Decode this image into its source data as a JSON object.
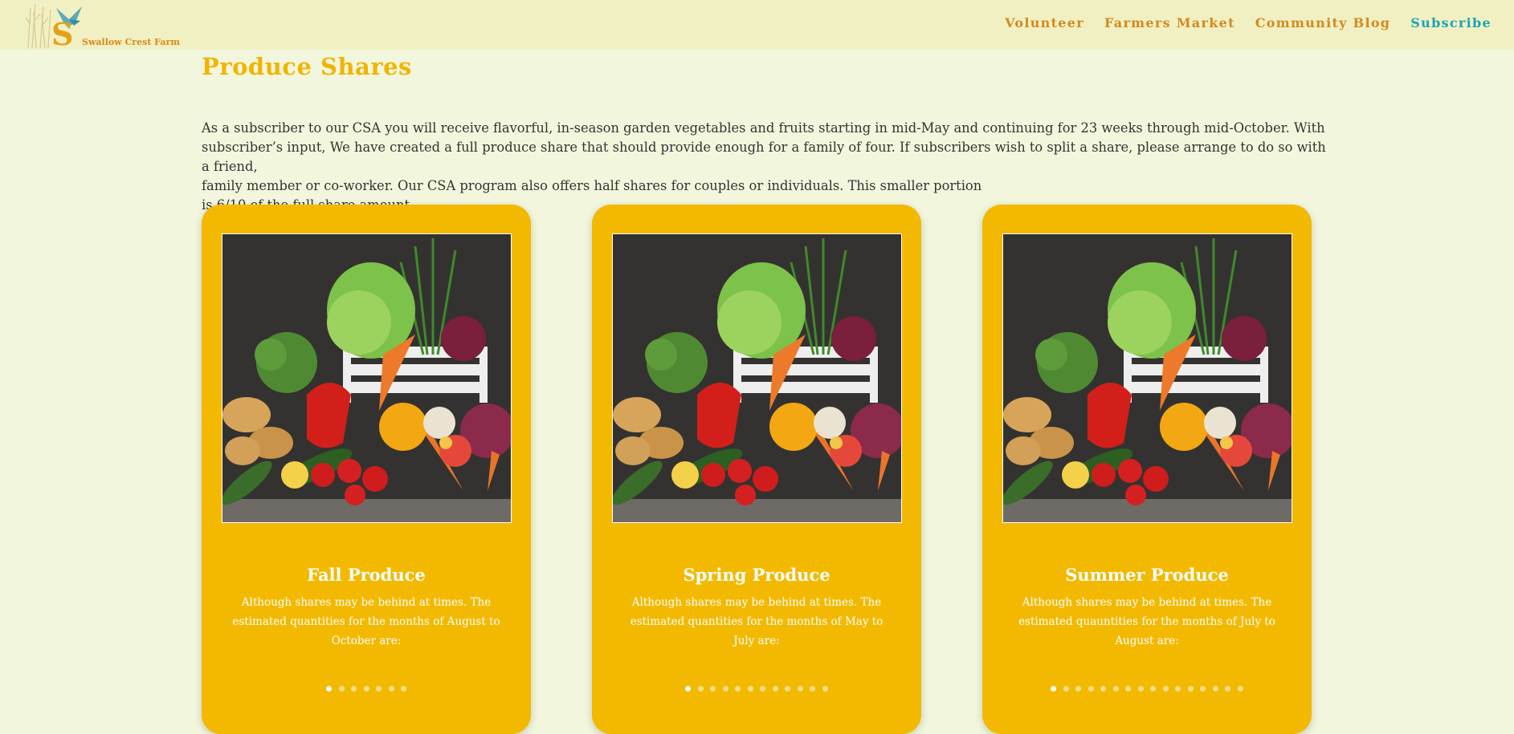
{
  "brand": {
    "name": "Swallow Crest Farm",
    "accent": "#f1b400",
    "nav_color": "#d28a1e",
    "active_color": "#1aa3b8"
  },
  "nav": [
    {
      "label": "Volunteer",
      "active": false
    },
    {
      "label": "Farmers Market",
      "active": false
    },
    {
      "label": "Community Blog",
      "active": false
    },
    {
      "label": "Subscribe",
      "active": true
    }
  ],
  "page": {
    "title": "Produce Shares",
    "intro_lines": [
      "As a subscriber to our CSA you will receive flavorful, in-season garden vegetables and fruits starting in mid-May and continuing for 23 weeks through mid-October. With",
      "subscriber’s input, We have created a full produce share that should provide enough for a family of four. If subscribers wish to split a share, please arrange to do so with a friend,",
      "family member or co-worker. Our CSA program also offers half shares for couples or individuals. This smaller portion",
      "is 6/10 of the full share amount."
    ]
  },
  "cards": [
    {
      "title": "Fall Produce",
      "text": "Although shares may be behind at times. The estimated quantities for the months of August to October are:",
      "image": "vegetable-crate-photo",
      "slide_count": 7,
      "active_slide": 1
    },
    {
      "title": "Spring Produce",
      "text": "Although shares may be behind at times. The estimated quantities for the months of May to July are:",
      "image": "vegetable-crate-photo",
      "slide_count": 12,
      "active_slide": 1
    },
    {
      "title": "Summer Produce",
      "text": "Although shares may be behind at times. The estimated quauntities for the months of July to August are:",
      "image": "vegetable-crate-photo",
      "slide_count": 16,
      "active_slide": 1
    }
  ]
}
